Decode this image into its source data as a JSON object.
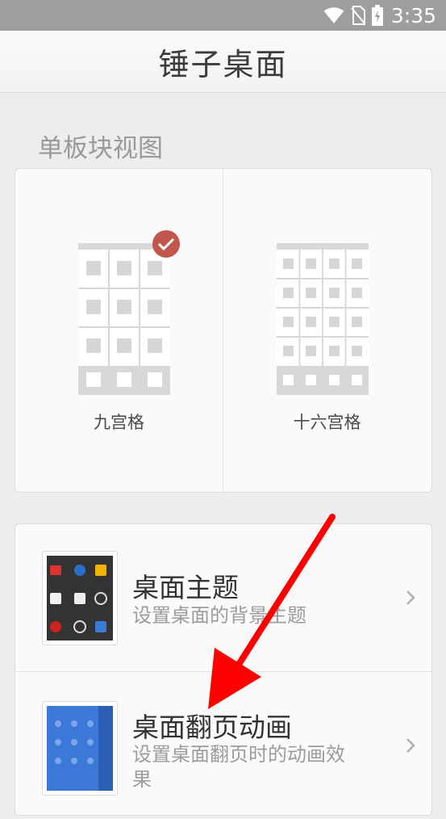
{
  "status_bar": {
    "time": "3:35"
  },
  "header": {
    "title": "锤子桌面"
  },
  "single_block_view": {
    "section_title": "单板块视图",
    "options": [
      {
        "label": "九宫格",
        "selected": true
      },
      {
        "label": "十六宫格",
        "selected": false
      }
    ]
  },
  "settings": {
    "items": [
      {
        "title": "桌面主题",
        "subtitle": "设置桌面的背景主题"
      },
      {
        "title": "桌面翻页动画",
        "subtitle": "设置桌面翻页时的动画效果"
      }
    ]
  },
  "colors": {
    "status_bar": "#9e9e9e",
    "background": "#ededed",
    "check_badge": "#c0564c",
    "annotation_arrow": "#ff0000"
  },
  "icons": [
    "wifi-icon",
    "no-sim-icon",
    "battery-icon",
    "check-icon",
    "chevron-right-icon"
  ]
}
